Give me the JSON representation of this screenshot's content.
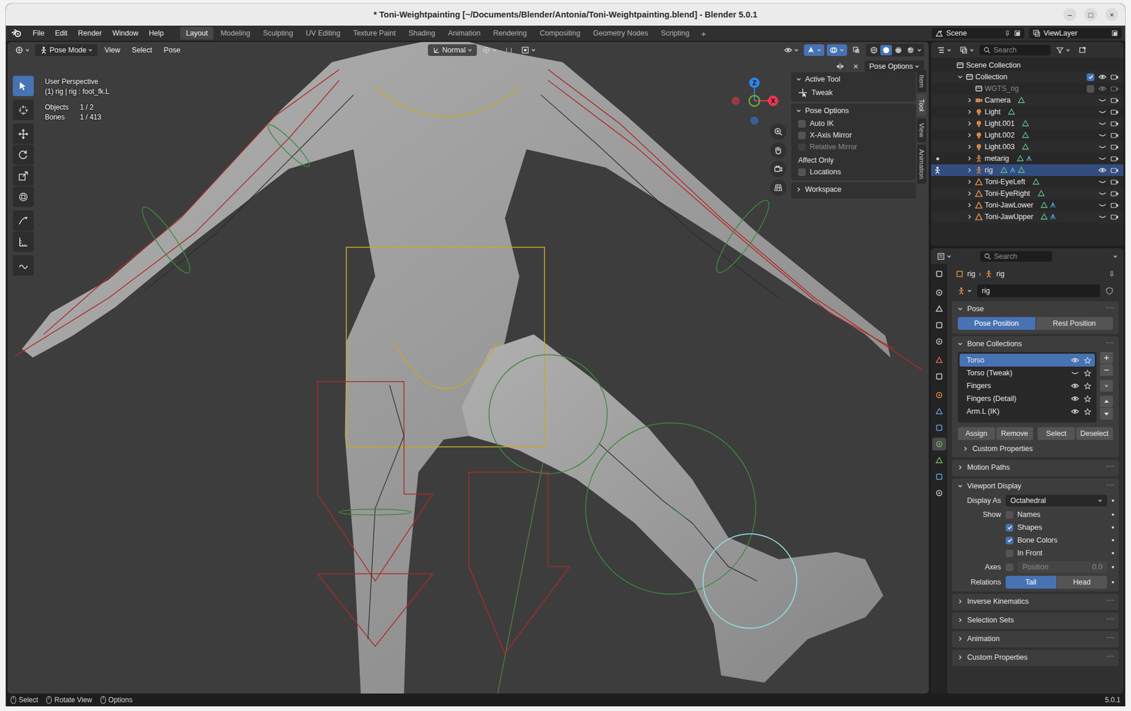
{
  "window": {
    "title": "* Toni-Weightpainting [~/Documents/Blender/Antonia/Toni-Weightpainting.blend] - Blender 5.0.1",
    "controls": [
      "–",
      "□",
      "×"
    ]
  },
  "menubar": {
    "menus": [
      "File",
      "Edit",
      "Render",
      "Window",
      "Help"
    ],
    "workspaces": [
      {
        "label": "Layout",
        "selected": true
      },
      {
        "label": "Modeling",
        "selected": false
      },
      {
        "label": "Sculpting",
        "selected": false
      },
      {
        "label": "UV Editing",
        "selected": false
      },
      {
        "label": "Texture Paint",
        "selected": false
      },
      {
        "label": "Shading",
        "selected": false
      },
      {
        "label": "Animation",
        "selected": false
      },
      {
        "label": "Rendering",
        "selected": false
      },
      {
        "label": "Compositing",
        "selected": false
      },
      {
        "label": "Geometry Nodes",
        "selected": false
      },
      {
        "label": "Scripting",
        "selected": false
      }
    ],
    "add": "+",
    "scene": "Scene",
    "view_layer": "ViewLayer"
  },
  "viewport": {
    "mode": "Pose Mode",
    "menus": [
      "View",
      "Select",
      "Pose"
    ],
    "orientation": "Normal",
    "options": "Pose Options",
    "info": [
      "User Perspective",
      "(1) rig | rig : foot_fk.L"
    ],
    "stats": [
      {
        "label": "Objects",
        "value": "1 / 2"
      },
      {
        "label": "Bones",
        "value": "1 / 413"
      }
    ],
    "tools": [
      {
        "selected": true
      },
      {
        "selected": false
      },
      {
        "selected": false
      },
      {
        "selected": false
      },
      {
        "selected": false
      },
      {
        "selected": false
      },
      {
        "selected": false
      },
      {
        "selected": false
      },
      {
        "selected": false
      }
    ],
    "shading": [
      {
        "selected": false
      },
      {
        "selected": true
      },
      {
        "selected": false
      },
      {
        "selected": false
      }
    ],
    "axes": [
      {
        "label": "Z",
        "color": "#2f83e6"
      },
      {
        "label": "X",
        "color": "#e8364f"
      }
    ],
    "view_axis_color": "#6ea73a"
  },
  "npanel": {
    "tabs": [
      {
        "label": "Item",
        "selected": false
      },
      {
        "label": "Tool",
        "selected": true
      },
      {
        "label": "View",
        "selected": false
      },
      {
        "label": "Animation",
        "selected": false
      }
    ],
    "active_tool": {
      "title": "Active Tool",
      "tool": "Tweak"
    },
    "pose_options": {
      "title": "Pose Options",
      "options": [
        {
          "label": "Auto IK",
          "checked": false,
          "disabled": false
        },
        {
          "label": "X-Axis Mirror",
          "checked": false,
          "disabled": false
        },
        {
          "label": "Relative Mirror",
          "checked": false,
          "disabled": true
        }
      ],
      "affect_title": "Affect Only",
      "affect": [
        {
          "label": "Locations",
          "checked": false,
          "disabled": false
        }
      ]
    },
    "workspace": "Workspace"
  },
  "outliner": {
    "search": "Search",
    "items": [
      {
        "name": "Scene Collection",
        "kind": "scene",
        "depth": 0,
        "expandable": false,
        "expanded": false,
        "selected": false,
        "disabled": false,
        "has_checkbox": false,
        "checked": false,
        "visible": true,
        "renderable": true,
        "show_toggles": false,
        "mode": "none",
        "extras": 0
      },
      {
        "name": "Collection",
        "kind": "collection",
        "depth": 1,
        "expandable": true,
        "expanded": true,
        "selected": false,
        "disabled": false,
        "has_checkbox": true,
        "checked": true,
        "visible": true,
        "renderable": true,
        "show_toggles": true,
        "mode": "none",
        "extras": 0
      },
      {
        "name": "WGTS_rig",
        "kind": "collection",
        "depth": 2,
        "expandable": false,
        "expanded": false,
        "selected": false,
        "disabled": true,
        "has_checkbox": true,
        "checked": false,
        "visible": true,
        "renderable": false,
        "show_toggles": true,
        "mode": "none",
        "extras": 0
      },
      {
        "name": "Camera",
        "kind": "camera",
        "depth": 2,
        "expandable": true,
        "expanded": false,
        "selected": false,
        "disabled": false,
        "has_checkbox": false,
        "checked": false,
        "visible": false,
        "renderable": true,
        "show_toggles": true,
        "mode": "none",
        "extras": 1
      },
      {
        "name": "Light",
        "kind": "light",
        "depth": 2,
        "expandable": true,
        "expanded": false,
        "selected": false,
        "disabled": false,
        "has_checkbox": false,
        "checked": false,
        "visible": false,
        "renderable": true,
        "show_toggles": true,
        "mode": "none",
        "extras": 1
      },
      {
        "name": "Light.001",
        "kind": "light",
        "depth": 2,
        "expandable": true,
        "expanded": false,
        "selected": false,
        "disabled": false,
        "has_checkbox": false,
        "checked": false,
        "visible": false,
        "renderable": true,
        "show_toggles": true,
        "mode": "none",
        "extras": 1
      },
      {
        "name": "Light.002",
        "kind": "light",
        "depth": 2,
        "expandable": true,
        "expanded": false,
        "selected": false,
        "disabled": false,
        "has_checkbox": false,
        "checked": false,
        "visible": false,
        "renderable": true,
        "show_toggles": true,
        "mode": "none",
        "extras": 1
      },
      {
        "name": "Light.003",
        "kind": "light",
        "depth": 2,
        "expandable": true,
        "expanded": false,
        "selected": false,
        "disabled": false,
        "has_checkbox": false,
        "checked": false,
        "visible": false,
        "renderable": true,
        "show_toggles": true,
        "mode": "none",
        "extras": 1
      },
      {
        "name": "metarig",
        "kind": "armature",
        "depth": 2,
        "expandable": true,
        "expanded": false,
        "selected": false,
        "disabled": false,
        "has_checkbox": false,
        "checked": false,
        "visible": false,
        "renderable": true,
        "show_toggles": true,
        "mode": "available",
        "extras": 2
      },
      {
        "name": "rig",
        "kind": "armature",
        "depth": 2,
        "expandable": true,
        "expanded": false,
        "selected": true,
        "disabled": false,
        "has_checkbox": false,
        "checked": false,
        "visible": true,
        "renderable": true,
        "show_toggles": true,
        "mode": "active",
        "extras": 3
      },
      {
        "name": "Toni-EyeLeft",
        "kind": "mesh",
        "depth": 2,
        "expandable": true,
        "expanded": false,
        "selected": false,
        "disabled": false,
        "has_checkbox": false,
        "checked": false,
        "visible": false,
        "renderable": true,
        "show_toggles": true,
        "mode": "none",
        "extras": 1
      },
      {
        "name": "Toni-EyeRight",
        "kind": "mesh",
        "depth": 2,
        "expandable": true,
        "expanded": false,
        "selected": false,
        "disabled": false,
        "has_checkbox": false,
        "checked": false,
        "visible": false,
        "renderable": true,
        "show_toggles": true,
        "mode": "none",
        "extras": 1
      },
      {
        "name": "Toni-JawLower",
        "kind": "mesh",
        "depth": 2,
        "expandable": true,
        "expanded": false,
        "selected": false,
        "disabled": false,
        "has_checkbox": false,
        "checked": false,
        "visible": false,
        "renderable": true,
        "show_toggles": true,
        "mode": "none",
        "extras": 2
      },
      {
        "name": "Toni-JawUpper",
        "kind": "mesh",
        "depth": 2,
        "expandable": true,
        "expanded": false,
        "selected": false,
        "disabled": false,
        "has_checkbox": false,
        "checked": false,
        "visible": false,
        "renderable": true,
        "show_toggles": true,
        "mode": "none",
        "extras": 2
      }
    ]
  },
  "properties": {
    "search": "Search",
    "tabs": [
      {
        "selected": false
      },
      {
        "selected": false
      },
      {
        "selected": false
      },
      {
        "selected": false
      },
      {
        "selected": false
      },
      {
        "selected": false
      },
      {
        "selected": false
      },
      {
        "selected": false
      },
      {
        "selected": false
      },
      {
        "selected": false
      },
      {
        "selected": true
      },
      {
        "selected": false
      },
      {
        "selected": false
      },
      {
        "selected": false
      }
    ],
    "breadcrumb": [
      "rig",
      "rig"
    ],
    "separator": "›",
    "datablock": "rig",
    "pose": {
      "title": "Pose",
      "buttons": [
        {
          "label": "Pose Position",
          "selected": true
        },
        {
          "label": "Rest Position",
          "selected": false
        }
      ]
    },
    "bone_collections": {
      "title": "Bone Collections",
      "items": [
        {
          "name": "Torso",
          "selected": true,
          "visible": true
        },
        {
          "name": "Torso (Tweak)",
          "selected": false,
          "visible": false
        },
        {
          "name": "Fingers",
          "selected": false,
          "visible": true
        },
        {
          "name": "Fingers (Detail)",
          "selected": false,
          "visible": true
        },
        {
          "name": "Arm.L (IK)",
          "selected": false,
          "visible": true
        }
      ],
      "buttons": [
        "Assign",
        "Remove",
        "Select",
        "Deselect"
      ],
      "custom": "Custom Properties"
    },
    "motion_paths": "Motion Paths",
    "viewport_display": {
      "title": "Viewport Display",
      "display_as_label": "Display As",
      "display_as": "Octahedral",
      "show_label": "Show",
      "show": [
        {
          "label": "Names",
          "checked": false
        },
        {
          "label": "Shapes",
          "checked": true
        },
        {
          "label": "Bone Colors",
          "checked": true
        },
        {
          "label": "In Front",
          "checked": false
        }
      ],
      "axes_label": "Axes",
      "axes": false,
      "axes_position_label": "Position",
      "axes_position": "0.0",
      "relations_label": "Relations",
      "relations": [
        {
          "label": "Tail",
          "selected": true
        },
        {
          "label": "Head",
          "selected": false
        }
      ]
    },
    "collapsed": [
      "Inverse Kinematics",
      "Selection Sets",
      "Animation",
      "Custom Properties"
    ]
  },
  "status_bar": {
    "hints": [
      "Select",
      "Rotate View",
      "Options"
    ],
    "version": "5.0.1"
  }
}
